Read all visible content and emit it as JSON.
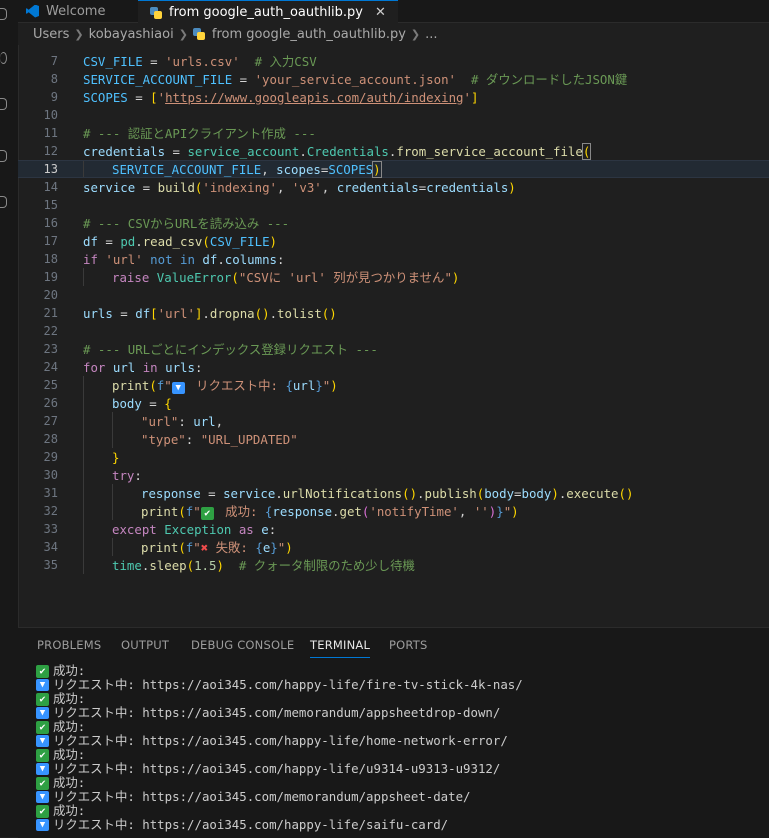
{
  "tabs": [
    {
      "label": "Welcome"
    },
    {
      "label": "from google_auth_oauthlib.py"
    }
  ],
  "breadcrumb": [
    "Users",
    "kobayashiaoi",
    "from google_auth_oauthlib.py",
    "..."
  ],
  "code": {
    "l7": {
      "v": "CSV_FILE",
      "s": "'urls.csv'",
      "c": "# 入力CSV"
    },
    "l8": {
      "v": "SERVICE_ACCOUNT_FILE",
      "s": "'your_service_account.json'",
      "c": "# ダウンロードしたJSON鍵"
    },
    "l9": {
      "v": "SCOPES",
      "s1": "'",
      "url": "https://www.googleapis.com/auth/indexing",
      "s2": "'"
    },
    "l11": {
      "c": "# --- 認証とAPIクライアント作成 ---"
    },
    "l12": {
      "a": "credentials",
      "b": "service_account",
      "c": "Credentials",
      "d": "from_service_account_file"
    },
    "l13": {
      "a": "SERVICE_ACCOUNT_FILE",
      "b": "scopes",
      "c": "SCOPES"
    },
    "l14": {
      "a": "service",
      "b": "build",
      "c": "'indexing'",
      "d": "'v3'",
      "e": "credentials",
      "f": "credentials"
    },
    "l16": {
      "c": "# --- CSVからURLを読み込み ---"
    },
    "l17": {
      "a": "df",
      "b": "pd",
      "c": "read_csv",
      "d": "CSV_FILE"
    },
    "l18": {
      "a": "if",
      "b": "'url'",
      "c": "not in",
      "d": "df",
      "e": "columns"
    },
    "l19": {
      "a": "raise",
      "b": "ValueError",
      "c": "\"CSVに 'url' 列が見つかりません\""
    },
    "l21": {
      "a": "urls",
      "b": "df",
      "c": "'url'",
      "d": "dropna",
      "e": "tolist"
    },
    "l23": {
      "c": "# --- URLごとにインデックス登録リクエスト ---"
    },
    "l24": {
      "a": "for",
      "b": "url",
      "c": "in",
      "d": "urls"
    },
    "l25": {
      "a": "print",
      "b": "f",
      "c": "\"",
      "d": " リクエスト中: ",
      "e": "url",
      "f": "\""
    },
    "l26": {
      "a": "body"
    },
    "l27": {
      "a": "\"url\"",
      "b": "url"
    },
    "l28": {
      "a": "\"type\"",
      "b": "\"URL_UPDATED\""
    },
    "l30": {
      "a": "try"
    },
    "l31": {
      "a": "response",
      "b": "service",
      "c": "urlNotifications",
      "d": "publish",
      "e": "body",
      "f": "body",
      "g": "execute"
    },
    "l32": {
      "a": "print",
      "b": "f",
      "c": "\"",
      "d": " 成功: ",
      "e": "response",
      "f": "get",
      "g": "'notifyTime'",
      "h": "''",
      "i": "\""
    },
    "l33": {
      "a": "except",
      "b": "Exception",
      "c": "as",
      "d": "e"
    },
    "l34": {
      "a": "print",
      "b": "f",
      "c": "\"",
      "d": " 失敗: ",
      "e": "e",
      "f": "\""
    },
    "l35": {
      "a": "time",
      "b": "sleep",
      "c": "1.5",
      "d": "# クォータ制限のため少し待機"
    }
  },
  "panel_tabs": [
    "PROBLEMS",
    "OUTPUT",
    "DEBUG CONSOLE",
    "TERMINAL",
    "PORTS"
  ],
  "terminal": {
    "success": "成功:",
    "request": "リクエスト中: ",
    "urls": [
      "https://aoi345.com/happy-life/fire-tv-stick-4k-nas/",
      "https://aoi345.com/memorandum/appsheetdrop-down/",
      "https://aoi345.com/happy-life/home-network-error/",
      "https://aoi345.com/happy-life/u9314-u9313-u9312/",
      "https://aoi345.com/memorandum/appsheet-date/",
      "https://aoi345.com/happy-life/saifu-card/"
    ]
  },
  "colors": {
    "accent": "#0078d4",
    "success_icon": "#2ea043",
    "error_icon": "#f14c4c"
  }
}
